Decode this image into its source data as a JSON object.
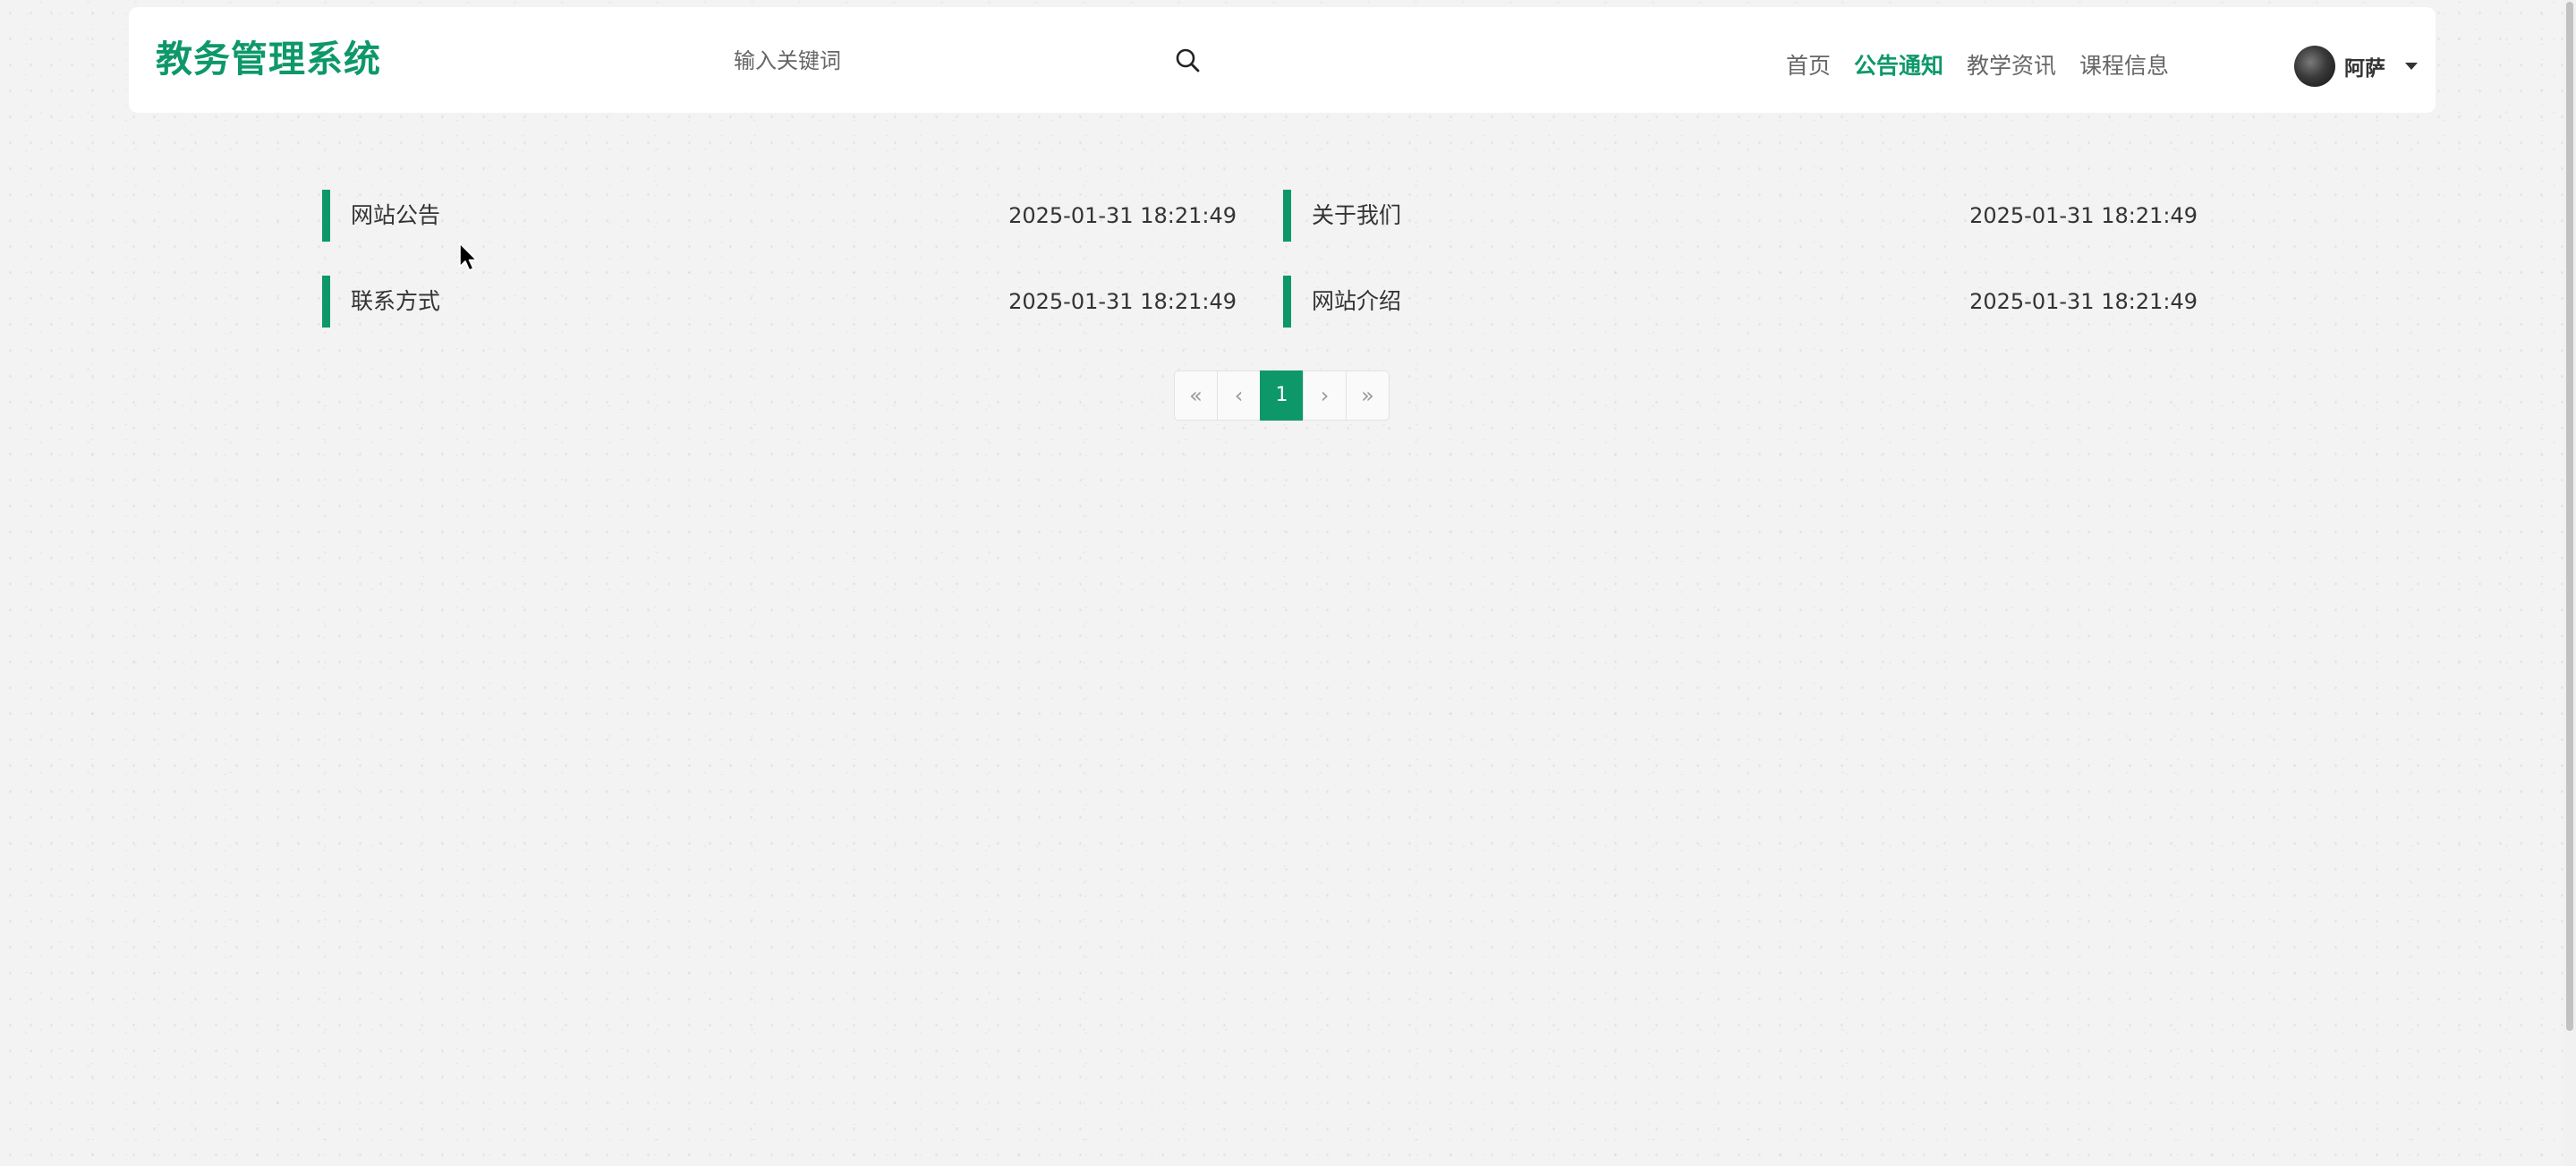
{
  "header": {
    "logo": "教务管理系统",
    "search": {
      "placeholder": "输入关键词",
      "value": ""
    },
    "nav": [
      {
        "label": "首页",
        "active": false
      },
      {
        "label": "公告通知",
        "active": true
      },
      {
        "label": "教学资讯",
        "active": false
      },
      {
        "label": "课程信息",
        "active": false
      }
    ],
    "user": {
      "name": "阿萨"
    }
  },
  "notices": [
    {
      "title": "网站公告",
      "date": "2025-01-31 18:21:49"
    },
    {
      "title": "关于我们",
      "date": "2025-01-31 18:21:49"
    },
    {
      "title": "联系方式",
      "date": "2025-01-31 18:21:49"
    },
    {
      "title": "网站介绍",
      "date": "2025-01-31 18:21:49"
    }
  ],
  "pagination": {
    "first": "«",
    "prev": "‹",
    "current": "1",
    "next": "›",
    "last": "»"
  },
  "colors": {
    "accent": "#0e9869",
    "background": "#f3f3f3",
    "text": "#333333"
  },
  "icons": {
    "search": "search-icon",
    "avatar": "avatar",
    "dropdown": "caret-down-icon"
  }
}
